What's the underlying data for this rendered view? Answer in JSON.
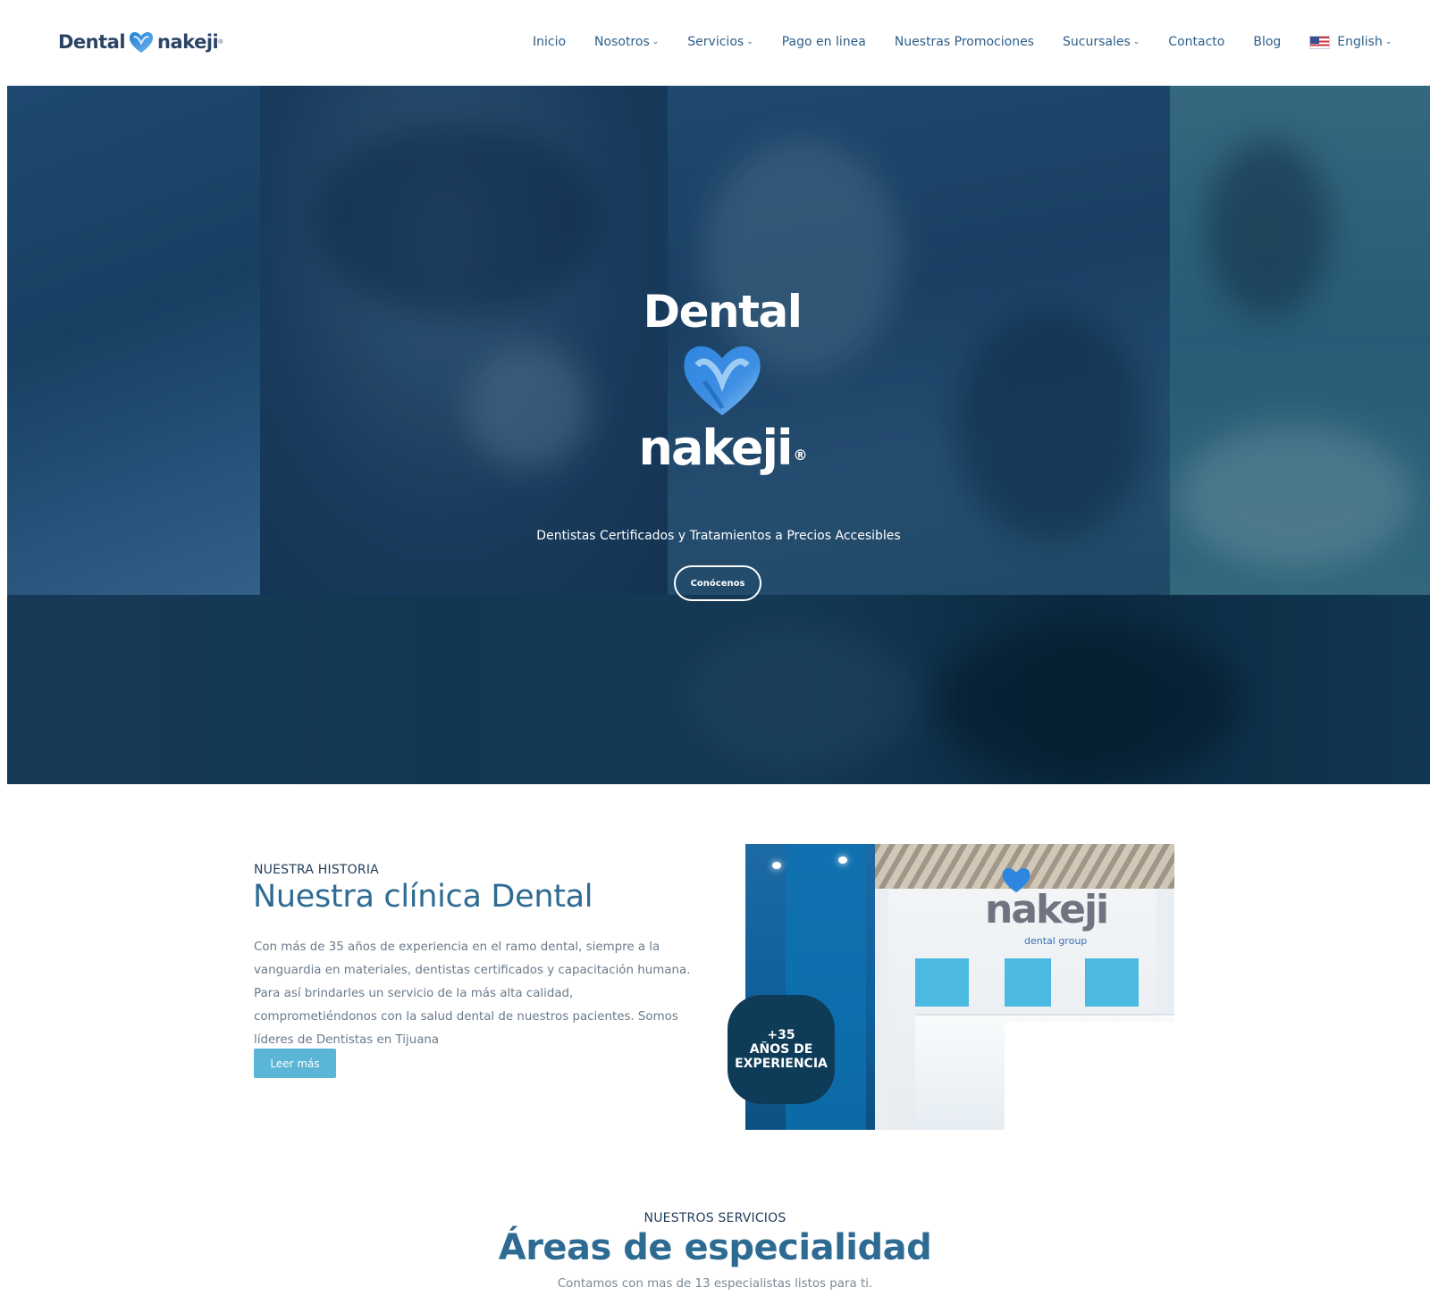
{
  "header": {
    "logo": {
      "word_left": "Dental",
      "word_right": "nakeji",
      "reg": "®"
    },
    "nav": [
      {
        "label": "Inicio",
        "dropdown": false
      },
      {
        "label": "Nosotros",
        "dropdown": true
      },
      {
        "label": "Servicios",
        "dropdown": true
      },
      {
        "label": "Pago en linea",
        "dropdown": false
      },
      {
        "label": "Nuestras Promociones",
        "dropdown": false
      },
      {
        "label": "Sucursales",
        "dropdown": true
      },
      {
        "label": "Contacto",
        "dropdown": false
      },
      {
        "label": "Blog",
        "dropdown": false
      }
    ],
    "language": {
      "label": "English",
      "flag_icon": "us-flag-icon"
    }
  },
  "hero": {
    "logo_top": "Dental",
    "logo_bottom": "nakeji",
    "logo_reg": "®",
    "tagline": "Dentistas Certificados y Tratamientos a Precios Accesibles",
    "button_label": "Conócenos"
  },
  "history": {
    "eyebrow": "NUESTRA HISTORIA",
    "title": "Nuestra clínica Dental",
    "body": "Con más de 35 años de experiencia en el ramo dental, siempre a la vanguardia en materiales, dentistas certificados y capacitación humana. Para así brindarles un servicio de la más alta calidad, comprometiéndonos con la salud dental de nuestros pacientes. Somos líderes de Dentistas en Tijuana",
    "button_label": "Leer más",
    "image": {
      "brand": "nakeji",
      "brand_sub": "dental group"
    },
    "badge": {
      "line1": "+35",
      "line2": "AÑOS DE",
      "line3": "EXPERIENCIA"
    }
  },
  "services": {
    "eyebrow": "NUESTROS SERVICIOS",
    "title": "Áreas de especialidad",
    "subtitle": "Contamos con mas de 13 especialistas listos para ti."
  },
  "colors": {
    "brand_dark": "#2b4466",
    "nav_text": "#2d5f8a",
    "accent_blue": "#2e6b93",
    "button_light_blue": "#5ab5d6",
    "badge_bg": "#0e3b57",
    "hero_overlay": "#12365a"
  }
}
